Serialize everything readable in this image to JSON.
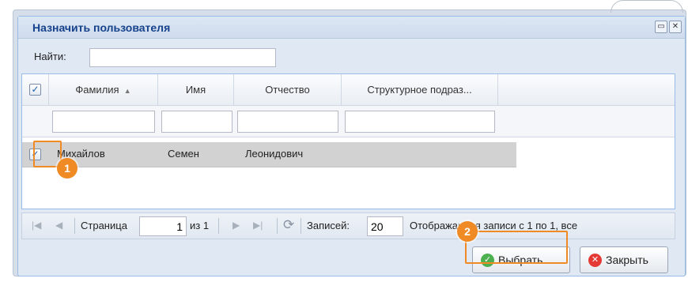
{
  "dialog": {
    "title": "Назначить пользователя",
    "maximize_icon": "maximize-icon",
    "close_icon": "close-icon"
  },
  "search": {
    "label": "Найти:",
    "value": ""
  },
  "grid": {
    "columns": [
      "Фамилия",
      "Имя",
      "Отчество",
      "Структурное подраз..."
    ],
    "sorted_column": "Фамилия",
    "sort_direction": "asc",
    "select_all_checked": true,
    "rows": [
      {
        "checked": true,
        "cells": [
          "Михайлов",
          "Семен",
          "Леонидович",
          ""
        ]
      }
    ]
  },
  "pager": {
    "page_label": "Страница",
    "page_value": "1",
    "page_of": "из 1",
    "records_label": "Записей:",
    "records_value": "20",
    "status": "Отображаются записи с 1 по 1, все"
  },
  "buttons": {
    "select_label": "Выбрать",
    "close_label": "Закрыть"
  },
  "annotations": [
    "1",
    "2"
  ],
  "colors": {
    "highlight": "#f08a24",
    "select_icon": "#4caf50",
    "close_icon": "#e53935",
    "title_text": "#15428b",
    "row_selected": "#d2d2d2"
  }
}
